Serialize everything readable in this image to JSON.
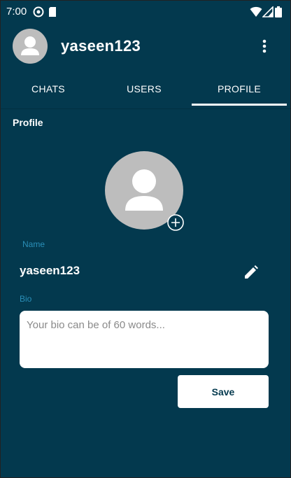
{
  "status_bar": {
    "time": "7:00",
    "icons": [
      "sync-icon",
      "sim-card-icon",
      "wifi-icon",
      "signal-icon",
      "battery-icon"
    ]
  },
  "app_bar": {
    "title": "yaseen123",
    "avatar_icon": "person-icon",
    "menu_icon": "more-vert-icon"
  },
  "tabs": [
    {
      "label": "CHATS",
      "selected": false
    },
    {
      "label": "USERS",
      "selected": false
    },
    {
      "label": "PROFILE",
      "selected": true
    }
  ],
  "profile": {
    "section_title": "Profile",
    "avatar_icon": "person-icon",
    "add_photo_icon": "add-circle-icon",
    "name_label": "Name",
    "name_value": "yaseen123",
    "edit_icon": "pencil-icon",
    "bio_label": "Bio",
    "bio_placeholder": "Your bio can be of 60 words...",
    "bio_value": "",
    "save_label": "Save"
  },
  "colors": {
    "background": "#03394e",
    "accent_label": "#2a8fb8",
    "avatar_grey": "#bdbdbd",
    "text": "#ffffff"
  }
}
